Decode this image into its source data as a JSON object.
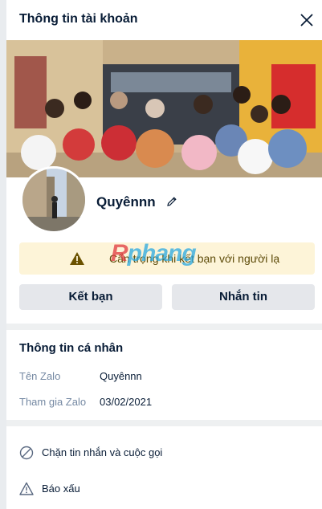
{
  "header": {
    "title": "Thông tin tài khoản"
  },
  "profile": {
    "name": "Quyênnn"
  },
  "warning": {
    "text": "Cẩn trọng khi kết bạn với người lạ"
  },
  "watermark": {
    "part1": "R",
    "part2": "phang"
  },
  "buttons": {
    "add_friend": "Kết bạn",
    "message": "Nhắn tin"
  },
  "personal": {
    "title": "Thông tin cá nhân",
    "rows": [
      {
        "label": "Tên Zalo",
        "value": "Quyênnn"
      },
      {
        "label": "Tham gia Zalo",
        "value": "03/02/2021"
      }
    ]
  },
  "actions": [
    {
      "label": "Chặn tin nhắn và cuộc gọi",
      "icon": "block-icon"
    },
    {
      "label": "Báo xấu",
      "icon": "warning-icon"
    }
  ],
  "colors": {
    "accent_text": "#081c36",
    "muted": "#7589a3",
    "warning_bg": "#fdf4d8",
    "button_bg": "#e5e7eb"
  }
}
